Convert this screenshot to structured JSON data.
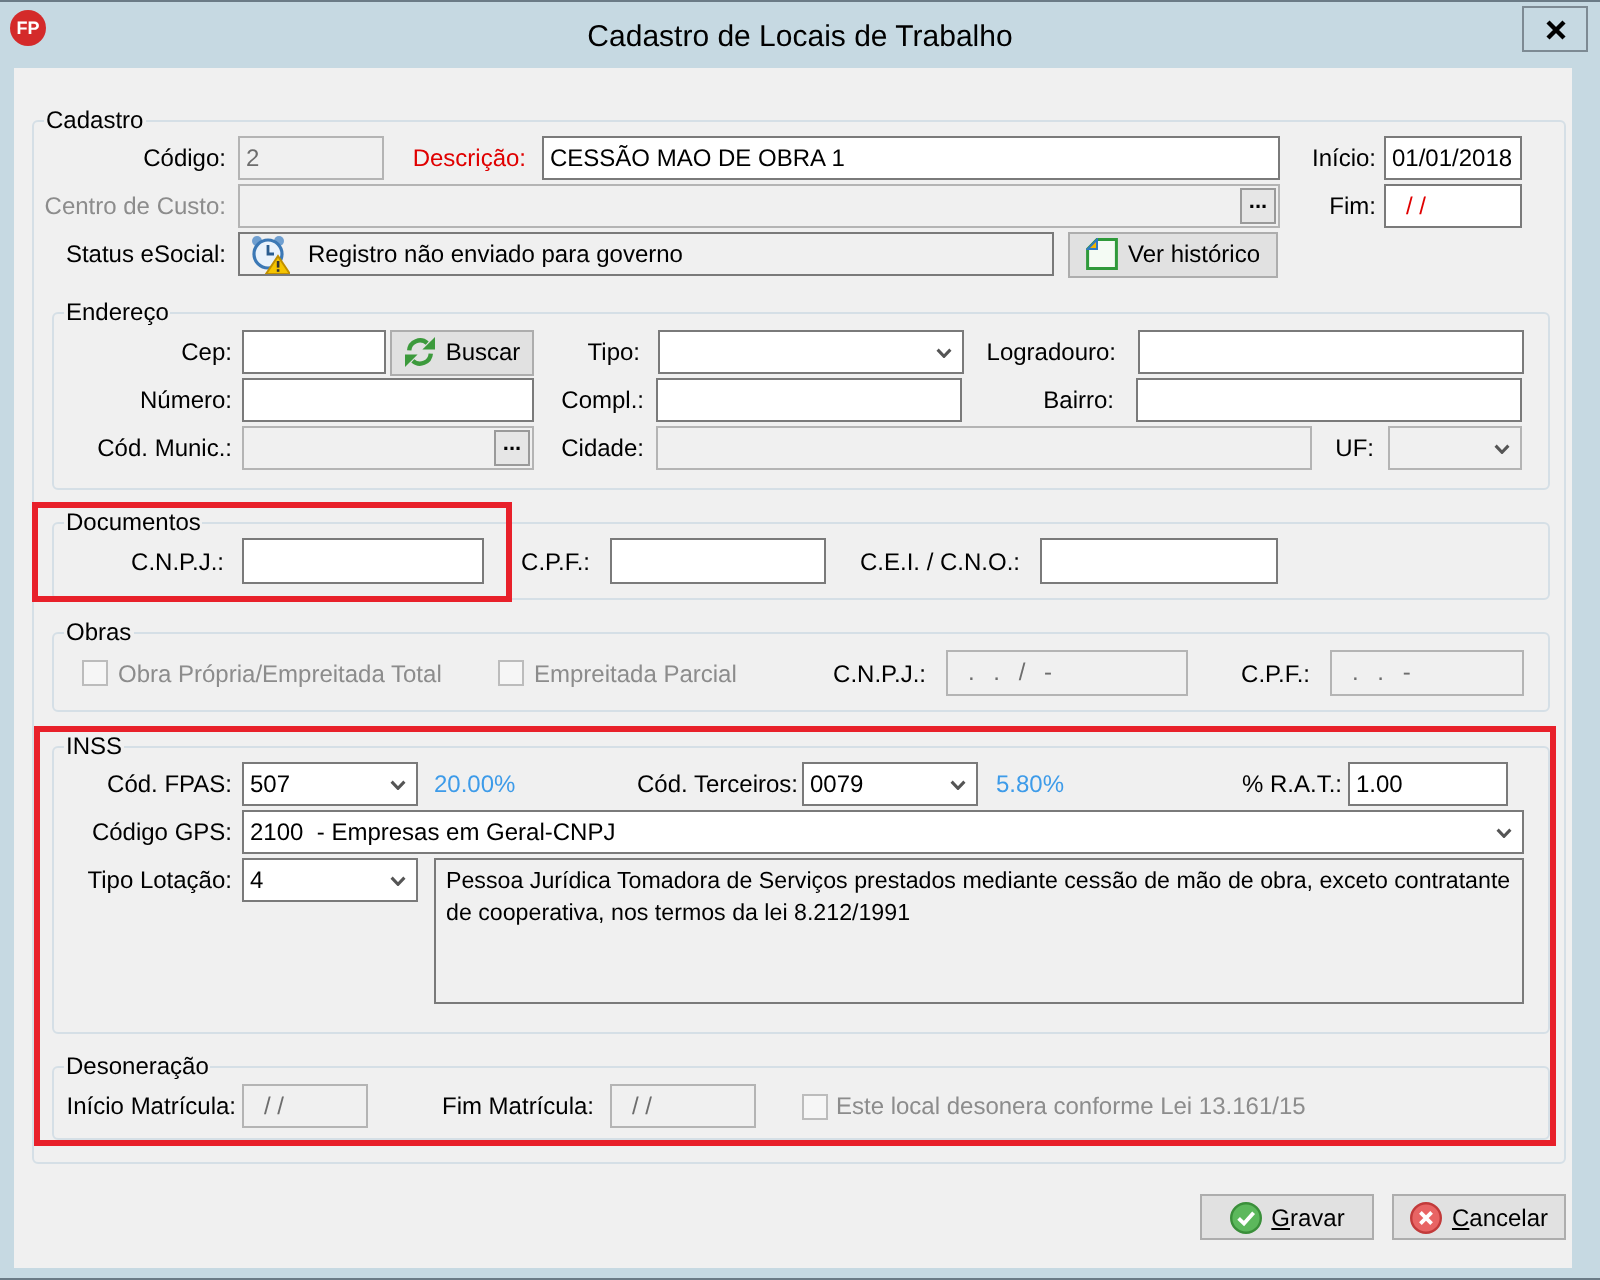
{
  "window": {
    "logo_text": "FP",
    "title": "Cadastro de Locais de Trabalho"
  },
  "cadastro": {
    "legend": "Cadastro",
    "codigo": {
      "label": "Código:",
      "value": "2",
      "readonly": true
    },
    "descricao": {
      "label": "Descrição:",
      "value": "CESSÃO MAO DE OBRA 1",
      "required": true
    },
    "inicio": {
      "label": "Início:",
      "value": "01/01/2018"
    },
    "centro_custo": {
      "label": "Centro de Custo:",
      "disabled": true,
      "button": "..."
    },
    "fim": {
      "label": "Fim:",
      "value": "/ /",
      "invalid": true
    },
    "status_esocial": {
      "label": "Status eSocial:",
      "value": "Registro não enviado para governo",
      "button": "Ver histórico"
    }
  },
  "endereco": {
    "legend": "Endereço",
    "cep": {
      "label": "Cep:",
      "button": "Buscar"
    },
    "tipo": {
      "label": "Tipo:"
    },
    "logradouro": {
      "label": "Logradouro:"
    },
    "numero": {
      "label": "Número:"
    },
    "compl": {
      "label": "Compl.:"
    },
    "bairro": {
      "label": "Bairro:"
    },
    "cod_munic": {
      "label": "Cód. Munic.:",
      "readonly": true,
      "button": "..."
    },
    "cidade": {
      "label": "Cidade:",
      "readonly": true
    },
    "uf": {
      "label": "UF:",
      "readonly": true
    }
  },
  "documentos": {
    "legend": "Documentos",
    "highlighted": true,
    "cnpj": {
      "label": "C.N.P.J.:"
    },
    "cpf": {
      "label": "C.P.F.:"
    },
    "cei_cno": {
      "label": "C.E.I. / C.N.O.:"
    }
  },
  "obras": {
    "legend": "Obras",
    "checkboxes": [
      {
        "label": "Obra Própria/Empreitada Total",
        "checked": false,
        "disabled": true
      },
      {
        "label": "Empreitada Parcial",
        "checked": false,
        "disabled": true
      }
    ],
    "cnpj": {
      "label": "C.N.P.J.:",
      "value": ". . / -",
      "readonly": true
    },
    "cpf": {
      "label": "C.P.F.:",
      "value": ". . -",
      "readonly": true
    }
  },
  "inss": {
    "legend": "INSS",
    "highlighted": true,
    "fpas": {
      "label": "Cód. FPAS:",
      "value": "507",
      "rate": "20.00%"
    },
    "terceiros": {
      "label": "Cód. Terceiros:",
      "value": "0079",
      "rate": "5.80%"
    },
    "rat": {
      "label": "% R.A.T.:",
      "value": "1.00"
    },
    "codigo_gps": {
      "label": "Código GPS:",
      "value": "2100  - Empresas em Geral-CNPJ"
    },
    "tipo_lotacao": {
      "label": "Tipo Lotação:",
      "value": "4",
      "description": "Pessoa Jurídica Tomadora de Serviços prestados mediante cessão de mão de obra, exceto contratante de cooperativa, nos termos da lei 8.212/1991"
    }
  },
  "desoneracao": {
    "legend": "Desoneração",
    "inicio_matricula": {
      "label": "Início Matrícula:",
      "value": "/ /",
      "readonly": true
    },
    "fim_matricula": {
      "label": "Fim Matrícula:",
      "value": "/ /",
      "readonly": true
    },
    "checkbox": {
      "label": "Este local desonera conforme Lei 13.161/15",
      "checked": false,
      "disabled": true
    }
  },
  "buttons": [
    {
      "label": "Gravar",
      "kind": "save"
    },
    {
      "label": "Cancelar",
      "kind": "cancel"
    }
  ]
}
